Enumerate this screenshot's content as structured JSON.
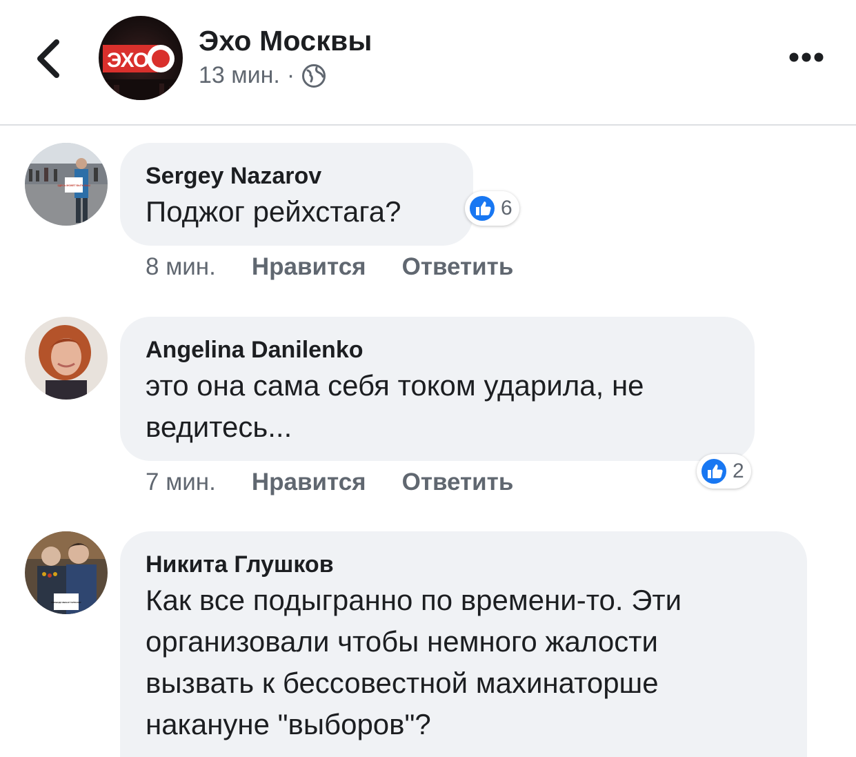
{
  "header": {
    "title": "Эхо Москвы",
    "time": "13 мин.",
    "separator": "·",
    "logo_text": "ЭХО",
    "back_icon": "chevron-left-icon",
    "privacy_icon": "globe-icon",
    "more_icon": "more-horizontal-icon"
  },
  "comments": [
    {
      "author": "Sergey Nazarov",
      "text": "Поджог рейхстага?",
      "time": "8 мин.",
      "like_label": "Нравится",
      "reply_label": "Ответить",
      "reaction_count": "6",
      "sign_text": "ЗДЕСЬ МОЖЕТ БЫТЬ ВАШ"
    },
    {
      "author": "Angelina Danilenko",
      "text_line1": "это она сама себя током ударила, не",
      "text_line2": "ведитесь...",
      "time": "7 мин.",
      "like_label": "Нравится",
      "reply_label": "Ответить",
      "reaction_count": "2"
    },
    {
      "author": "Никита Глушков",
      "text_line1": "Как все подыгранно по времени-то. Эти",
      "text_line2": "организовали чтобы немного жалости",
      "text_line3": "вызвать к бессовестной махинаторше",
      "text_line4": "накануне \"выборов\"?",
      "sign_text": "СВОБОДУ ИВАНУ ГОЛУНОВУ"
    }
  ],
  "colors": {
    "like_blue": "#1877f2",
    "bubble_bg": "#f0f2f5",
    "secondary_text": "#606770",
    "logo_red": "#d9302c"
  }
}
